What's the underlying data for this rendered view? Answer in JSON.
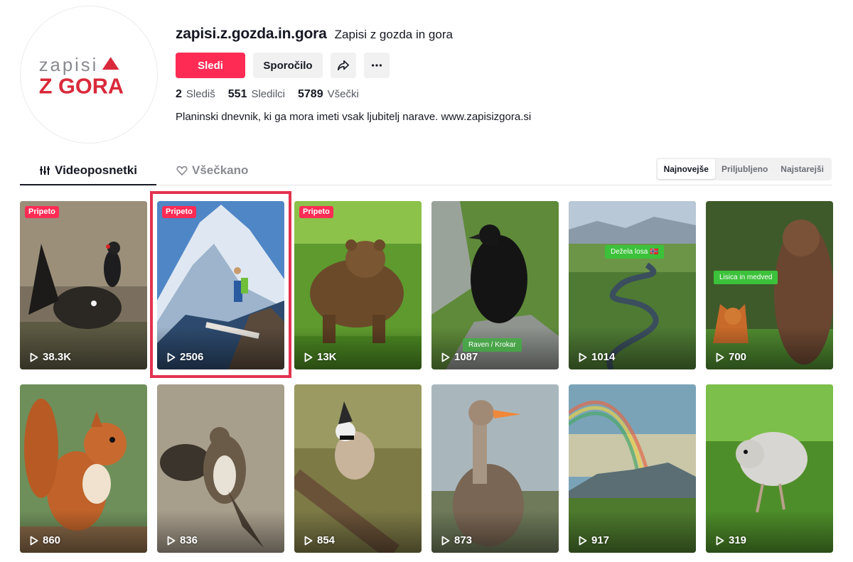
{
  "profile": {
    "avatar_logo_line1": "zapisi",
    "avatar_logo_line2": "Z GORA",
    "username": "zapisi.z.gozda.in.gora",
    "nickname": "Zapisi z gozda in gora",
    "follow_label": "Sledi",
    "message_label": "Sporočilo",
    "share_icon": "share-icon",
    "more_icon": "more-icon",
    "stats": [
      {
        "value": "2",
        "label": "Slediš"
      },
      {
        "value": "551",
        "label": "Sledilci"
      },
      {
        "value": "5789",
        "label": "Všečki"
      }
    ],
    "bio": "Planinski dnevnik, ki ga mora imeti vsak ljubitelj narave. www.zapisizgora.si"
  },
  "tabs": [
    {
      "label": "Videoposnetki",
      "icon": "grid-icon",
      "active": true
    },
    {
      "label": "Všečkano",
      "icon": "heart-lock-icon",
      "active": false
    }
  ],
  "sort": [
    {
      "label": "Najnovejše",
      "active": true
    },
    {
      "label": "Priljubljeno",
      "active": false
    },
    {
      "label": "Najstarejši",
      "active": false
    }
  ],
  "videos": [
    {
      "views": "38.3K",
      "badge": "Pripeto",
      "scene": "capercaillie"
    },
    {
      "views": "2506",
      "badge": "Pripeto",
      "scene": "mountain-hiker",
      "highlighted": true
    },
    {
      "views": "13K",
      "badge": "Pripeto",
      "scene": "brown-bear"
    },
    {
      "views": "1087",
      "badge": "",
      "scene": "raven",
      "label": "Raven / Krokar"
    },
    {
      "views": "1014",
      "badge": "",
      "scene": "river-valley",
      "label": "Dežela losa 🇳🇴"
    },
    {
      "views": "700",
      "badge": "",
      "scene": "fox-bear",
      "label": "Lisica in medved"
    },
    {
      "views": "860",
      "badge": "",
      "scene": "red-squirrel"
    },
    {
      "views": "836",
      "badge": "",
      "scene": "sand-martin"
    },
    {
      "views": "854",
      "badge": "",
      "scene": "crested-tit"
    },
    {
      "views": "873",
      "badge": "",
      "scene": "greylag-goose"
    },
    {
      "views": "917",
      "badge": "",
      "scene": "rainbow-meadow"
    },
    {
      "views": "319",
      "badge": "",
      "scene": "chick"
    }
  ],
  "colors": {
    "accent": "#fe2c55",
    "highlight_box": "#e2334f",
    "label_green": "#3cc13b"
  }
}
